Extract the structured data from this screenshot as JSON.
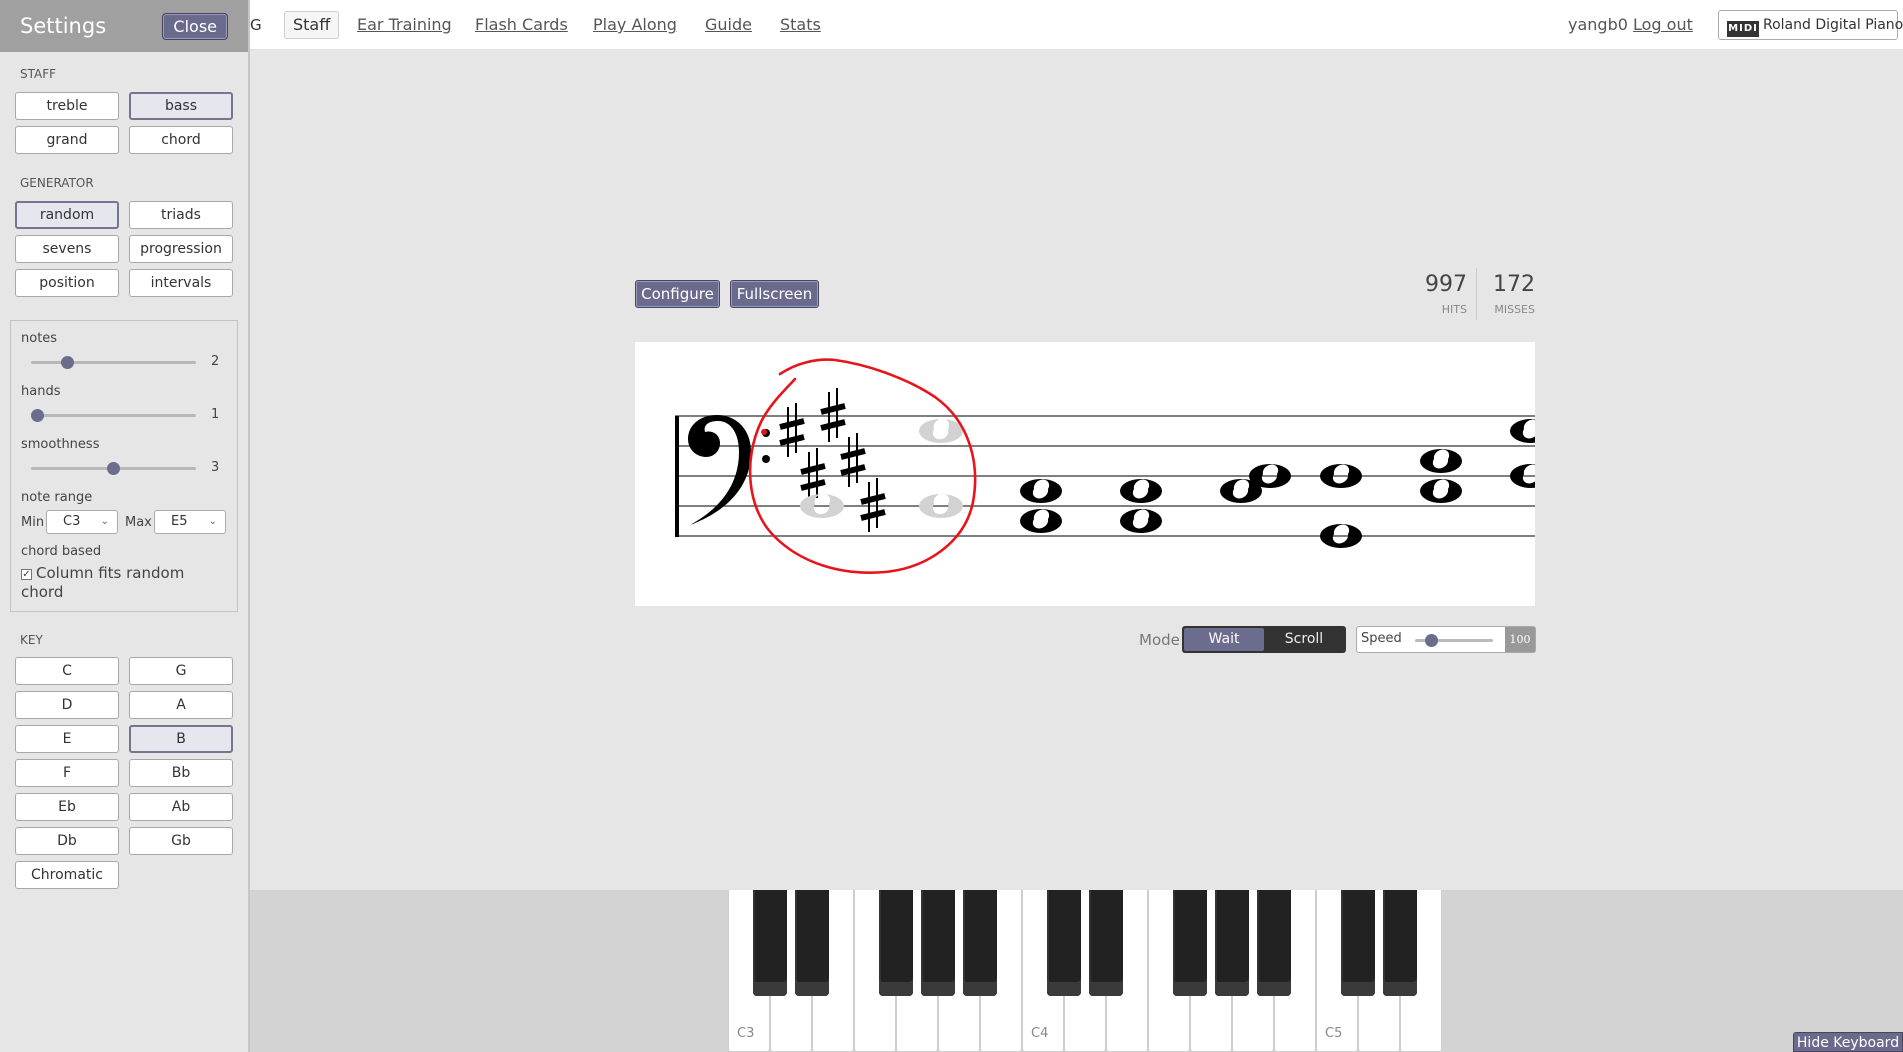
{
  "sidebar": {
    "title": "Settings",
    "close_label": "Close",
    "staff": {
      "label": "STAFF",
      "options": [
        "treble",
        "bass",
        "grand",
        "chord"
      ],
      "active": "bass"
    },
    "generator": {
      "label": "GENERATOR",
      "options": [
        "random",
        "triads",
        "sevens",
        "progression",
        "position",
        "intervals"
      ],
      "active": "random"
    },
    "params": {
      "notes": {
        "label": "notes",
        "value": "2",
        "level": 0.2
      },
      "hands": {
        "label": "hands",
        "value": "1",
        "level": 0.0
      },
      "smoothness": {
        "label": "smoothness",
        "value": "3",
        "level": 0.5
      },
      "note_range": {
        "label": "note range",
        "min_label": "Min",
        "min_value": "C3",
        "max_label": "Max",
        "max_value": "E5"
      },
      "chord_based": {
        "label": "chord based",
        "checkbox_label": "Column fits random chord",
        "checked": true
      }
    },
    "key": {
      "label": "KEY",
      "options": [
        "C",
        "G",
        "D",
        "A",
        "E",
        "B",
        "F",
        "Bb",
        "Eb",
        "Ab",
        "Db",
        "Gb",
        "Chromatic"
      ],
      "active": "B"
    }
  },
  "nav": {
    "brand_stub": "G",
    "tabs": [
      "Staff",
      "Ear Training",
      "Flash Cards",
      "Play Along",
      "Guide",
      "Stats"
    ],
    "active_tab": "Staff",
    "username": "yangb0",
    "logout_label": "Log out",
    "midi_icon_text": "MIDI",
    "midi_device": "Roland Digital Piano"
  },
  "main": {
    "configure_label": "Configure",
    "fullscreen_label": "Fullscreen",
    "hits": {
      "value": "997",
      "label": "HITS"
    },
    "misses": {
      "value": "172",
      "label": "MISSES"
    },
    "mode_label": "Mode",
    "mode_options": [
      "Wait",
      "Scroll"
    ],
    "mode_active": "Wait",
    "speed_label": "Speed",
    "speed_value": "100",
    "speed_level": 0.15
  },
  "keyboard": {
    "octave_labels": [
      "C3",
      "C4",
      "C5"
    ],
    "hide_label": "Hide Keyboard"
  },
  "colors": {
    "accent": "#6a6a8c",
    "annotation": "#e8141c"
  }
}
